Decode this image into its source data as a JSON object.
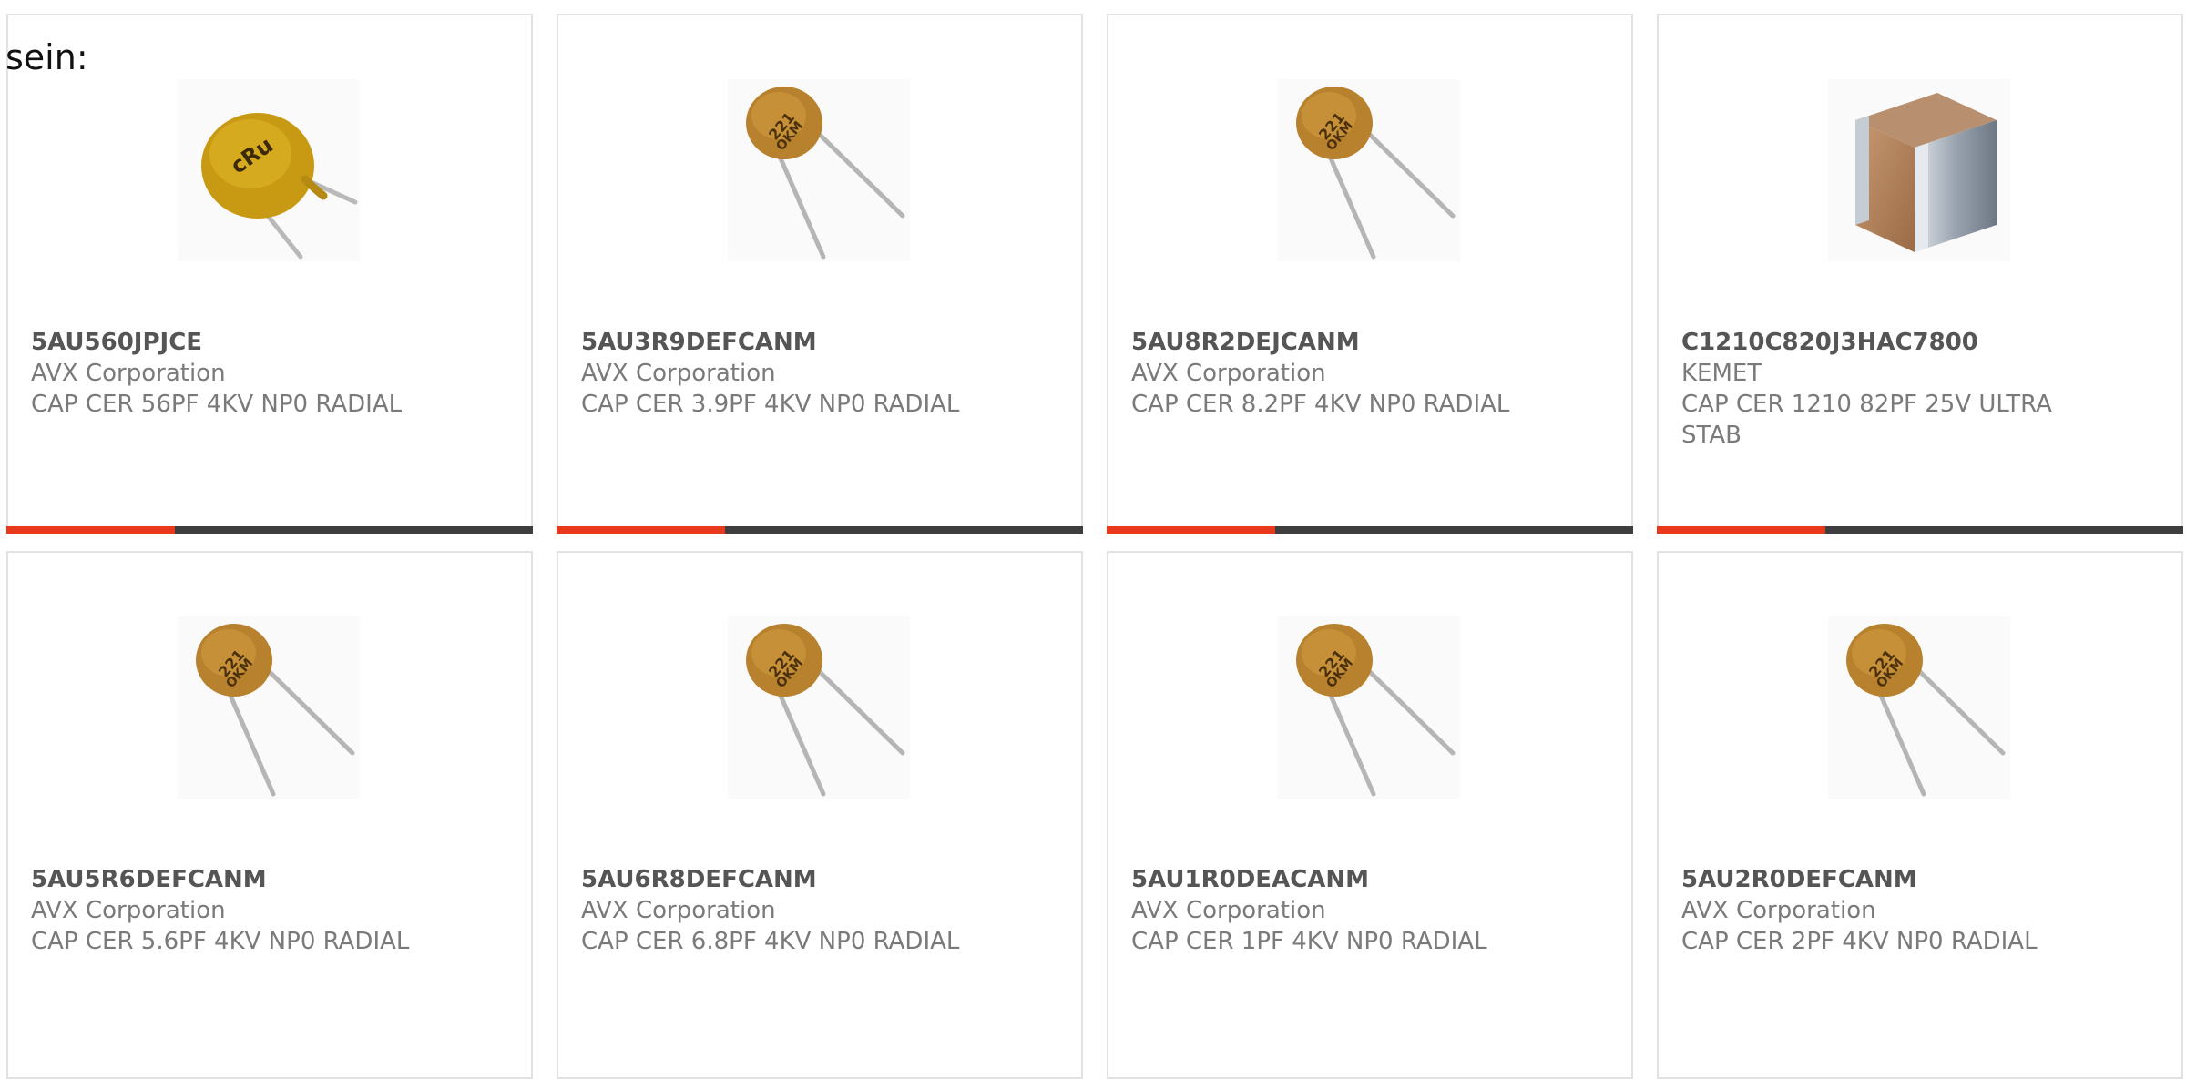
{
  "page_label": "sein:",
  "colors": {
    "accent": "#e8391c",
    "bar_track": "#3e3e3e",
    "card_border": "#e2e2e2",
    "part_number_text": "#555555",
    "secondary_text": "#7a7a7a"
  },
  "products": [
    {
      "part_number": "5AU560JPJCE",
      "manufacturer": "AVX Corporation",
      "description": "CAP CER 56PF 4KV NP0 RADIAL",
      "image_icon": "yellow-disc-capacitor-icon",
      "progress": 0.32
    },
    {
      "part_number": "5AU3R9DEFCANM",
      "manufacturer": "AVX Corporation",
      "description": "CAP CER 3.9PF 4KV NP0 RADIAL",
      "image_icon": "disc-capacitor-icon",
      "progress": 0.32
    },
    {
      "part_number": "5AU8R2DEJCANM",
      "manufacturer": "AVX Corporation",
      "description": "CAP CER 8.2PF 4KV NP0 RADIAL",
      "image_icon": "disc-capacitor-icon",
      "progress": 0.32
    },
    {
      "part_number": "C1210C820J3HAC7800",
      "manufacturer": "KEMET",
      "description": "CAP CER 1210 82PF 25V ULTRA STAB",
      "image_icon": "smd-chip-capacitor-icon",
      "progress": 0.32
    },
    {
      "part_number": "5AU5R6DEFCANM",
      "manufacturer": "AVX Corporation",
      "description": "CAP CER 5.6PF 4KV NP0 RADIAL",
      "image_icon": "disc-capacitor-icon"
    },
    {
      "part_number": "5AU6R8DEFCANM",
      "manufacturer": "AVX Corporation",
      "description": "CAP CER 6.8PF 4KV NP0 RADIAL",
      "image_icon": "disc-capacitor-icon"
    },
    {
      "part_number": "5AU1R0DEACANM",
      "manufacturer": "AVX Corporation",
      "description": "CAP CER 1PF 4KV NP0 RADIAL",
      "image_icon": "disc-capacitor-icon"
    },
    {
      "part_number": "5AU2R0DEFCANM",
      "manufacturer": "AVX Corporation",
      "description": "CAP CER 2PF 4KV NP0 RADIAL",
      "image_icon": "disc-capacitor-icon"
    }
  ]
}
